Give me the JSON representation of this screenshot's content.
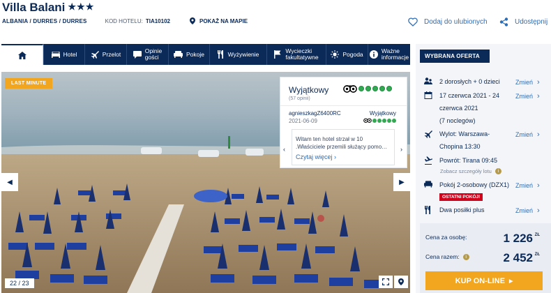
{
  "hotel": {
    "name": "Villa Balani",
    "stars": "★★★",
    "location": "ALBANIA / DURRES / DURRES",
    "code_label": "KOD HOTELU:",
    "code_value": "TIA10102",
    "map_link": "POKAŻ NA MAPIE",
    "favorite_label": "Dodaj do ulubionych",
    "share_label": "Udostępnij"
  },
  "nav": {
    "tabs": [
      {
        "label": "Hotel"
      },
      {
        "label": "Przelot"
      },
      {
        "line1": "Opinie",
        "line2": "gości"
      },
      {
        "label": "Pokoje"
      },
      {
        "label": "Wyżywienie"
      },
      {
        "line1": "Wycieczki",
        "line2": "fakultatywne"
      },
      {
        "label": "Pogoda"
      },
      {
        "line1": "Ważne",
        "line2": "informacje"
      }
    ]
  },
  "gallery": {
    "badge": "LAST MINUTE",
    "counter": "22 / 23"
  },
  "review": {
    "rating_label": "Wyjątkowy",
    "count": "(57 opinii)",
    "author": "agnieszkagZ6400RC",
    "author_rating": "Wyjątkowy",
    "date": "2021-06-09",
    "text_line1": "Witam ten hotel strzał w 10",
    "text_line2": ".Właściciele przemili służący pomo…",
    "more_link": "Czytaj więcej"
  },
  "offer": {
    "heading": "WYBRANA OFERTA",
    "guests": "2 dorosłych + 0 dzieci",
    "date_line1": "17 czerwca 2021 - 24",
    "date_line2": "czerwca 2021",
    "date_line3": "(7 noclegów)",
    "departure_line1": "Wylot: Warszawa-",
    "departure_line2": "Chopina 13:30",
    "return": "Powrót: Tirana 09:45",
    "flight_details": "Zobacz szczegóły lotu",
    "room": "Pokój 2-osobowy (DZX1)",
    "last_room": "OSTATNI POKÓJ!",
    "board": "Dwa posiłki plus",
    "change_label": "Zmień",
    "price_person_label": "Cena za osobę:",
    "price_person": "1 226",
    "price_total_label": "Cena razem:",
    "price_total": "2 452",
    "currency": "ZŁ",
    "buy_label": "KUP ON-LINE"
  },
  "colors": {
    "navy": "#0c2a57",
    "accent": "#f2a51f",
    "link": "#2f6db5",
    "warning": "#d0021b"
  }
}
